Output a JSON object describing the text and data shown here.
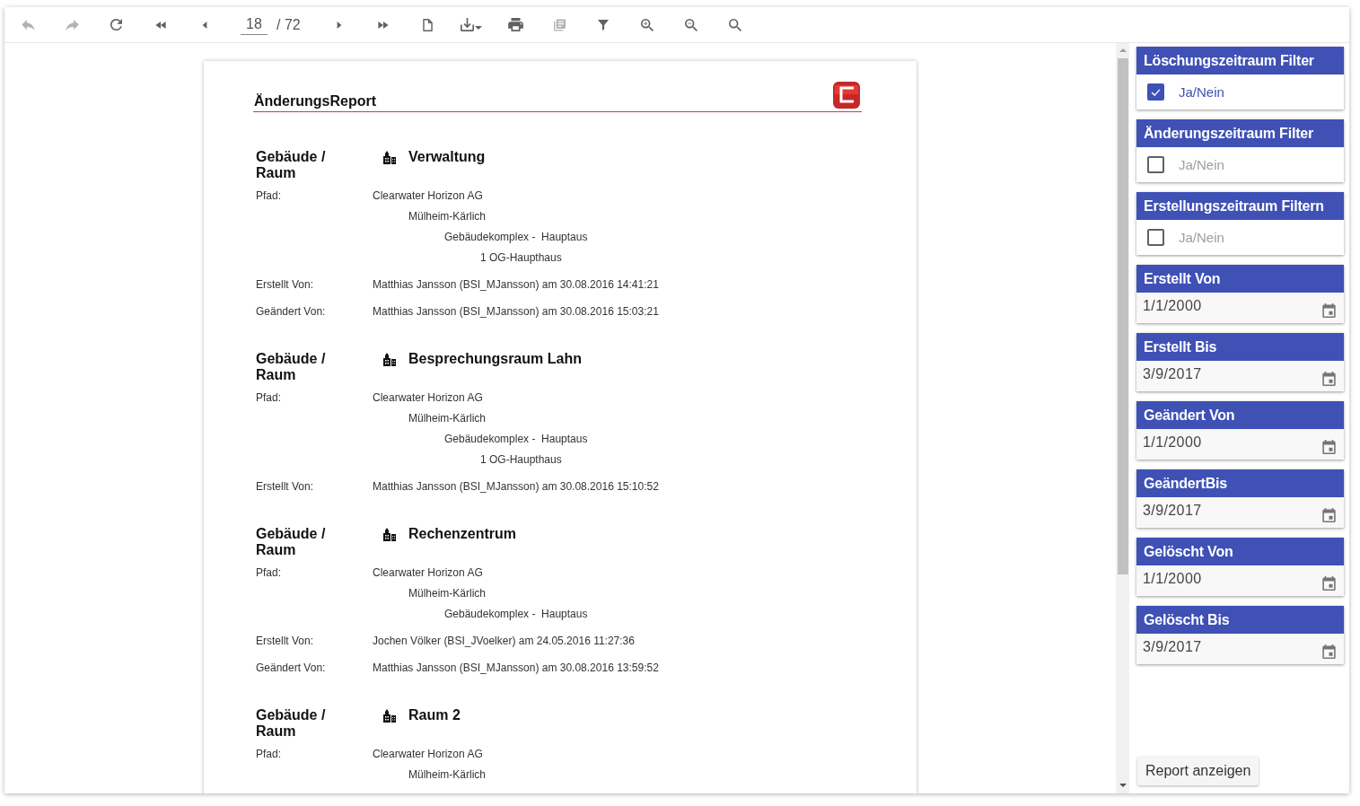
{
  "toolbar": {
    "buttons_left": [
      {
        "kind": "back",
        "disabled": true
      },
      {
        "kind": "forward",
        "disabled": true
      },
      {
        "kind": "refresh",
        "disabled": false
      },
      {
        "kind": "first",
        "disabled": false
      },
      {
        "kind": "previous",
        "disabled": false
      }
    ],
    "page_field": {
      "value": "18"
    },
    "page_total": "/ 72",
    "buttons_right": [
      {
        "kind": "next",
        "disabled": false
      },
      {
        "kind": "last",
        "disabled": false
      },
      {
        "kind": "page",
        "disabled": false
      },
      {
        "kind": "export",
        "disabled": false
      },
      {
        "kind": "print",
        "disabled": false
      },
      {
        "kind": "copies",
        "disabled": true
      },
      {
        "kind": "filter",
        "disabled": false
      },
      {
        "kind": "zoom_in",
        "disabled": false
      },
      {
        "kind": "zoom_out",
        "disabled": false
      },
      {
        "kind": "search",
        "disabled": false
      }
    ]
  },
  "report": {
    "title": "ÄnderungsReport",
    "records": [
      {
        "heading": "Gebäude / Raum",
        "name": "Verwaltung",
        "path_label": "Pfad:",
        "path": [
          {
            "text": "Clearwater Horizon AG",
            "children": [
              {
                "text": "Mülheim-Kärlich",
                "children": [
                  {
                    "text": "Gebäudekomplex -  Hauptaus",
                    "children": [
                      {
                        "text": "1 OG-Haupthaus"
                      }
                    ]
                  }
                ]
              }
            ]
          }
        ],
        "entries": [
          {
            "label": "Erstellt Von:",
            "value": "Matthias Jansson (BSI_MJansson) am 30.08.2016 14:41:21"
          },
          {
            "label": "Geändert Von:",
            "value": "Matthias Jansson (BSI_MJansson) am 30.08.2016 15:03:21"
          }
        ]
      },
      {
        "heading": "Gebäude / Raum",
        "name": "Besprechungsraum Lahn",
        "path_label": "Pfad:",
        "path": [
          {
            "text": "Clearwater Horizon AG",
            "children": [
              {
                "text": "Mülheim-Kärlich",
                "children": [
                  {
                    "text": "Gebäudekomplex -  Hauptaus",
                    "children": [
                      {
                        "text": "1 OG-Haupthaus"
                      }
                    ]
                  }
                ]
              }
            ]
          }
        ],
        "entries": [
          {
            "label": "Erstellt Von:",
            "value": "Matthias Jansson (BSI_MJansson) am 30.08.2016 15:10:52"
          }
        ]
      },
      {
        "heading": "Gebäude / Raum",
        "name": "Rechenzentrum",
        "path_label": "Pfad:",
        "path": [
          {
            "text": "Clearwater Horizon AG",
            "children": [
              {
                "text": "Mülheim-Kärlich",
                "children": [
                  {
                    "text": "Gebäudekomplex -  Hauptaus"
                  }
                ]
              }
            ]
          }
        ],
        "entries": [
          {
            "label": "Erstellt Von:",
            "value": "Jochen Völker (BSI_JVoelker) am 24.05.2016 11:27:36"
          },
          {
            "label": "Geändert Von:",
            "value": "Matthias Jansson (BSI_MJansson) am 30.08.2016 13:59:52"
          }
        ]
      },
      {
        "heading": "Gebäude / Raum",
        "name": "Raum 2",
        "path_label": "Pfad:",
        "path": [
          {
            "text": "Clearwater Horizon AG",
            "children": [
              {
                "text": "Mülheim-Kärlich"
              }
            ]
          }
        ]
      }
    ]
  },
  "sidebar": {
    "filters": [
      {
        "kind": "checkbox",
        "title": "Löschungszeitraum Filter",
        "label": "Ja/Nein",
        "checked": true
      },
      {
        "kind": "checkbox",
        "title": "Änderungszeitraum Filter",
        "label": "Ja/Nein",
        "checked": false
      },
      {
        "kind": "checkbox",
        "title": "Erstellungszeitraum Filtern",
        "label": "Ja/Nein",
        "checked": false
      },
      {
        "kind": "date",
        "title": "Erstellt Von",
        "value": "1/1/2000"
      },
      {
        "kind": "date",
        "title": "Erstellt Bis",
        "value": "3/9/2017"
      },
      {
        "kind": "date",
        "title": "Geändert Von",
        "value": "1/1/2000"
      },
      {
        "kind": "date",
        "title": "GeändertBis",
        "value": "3/9/2017"
      },
      {
        "kind": "date",
        "title": "Gelöscht Von",
        "value": "1/1/2000"
      },
      {
        "kind": "date",
        "title": "Gelöscht Bis",
        "value": "3/9/2017"
      }
    ],
    "submit_button": "Report anzeigen"
  }
}
